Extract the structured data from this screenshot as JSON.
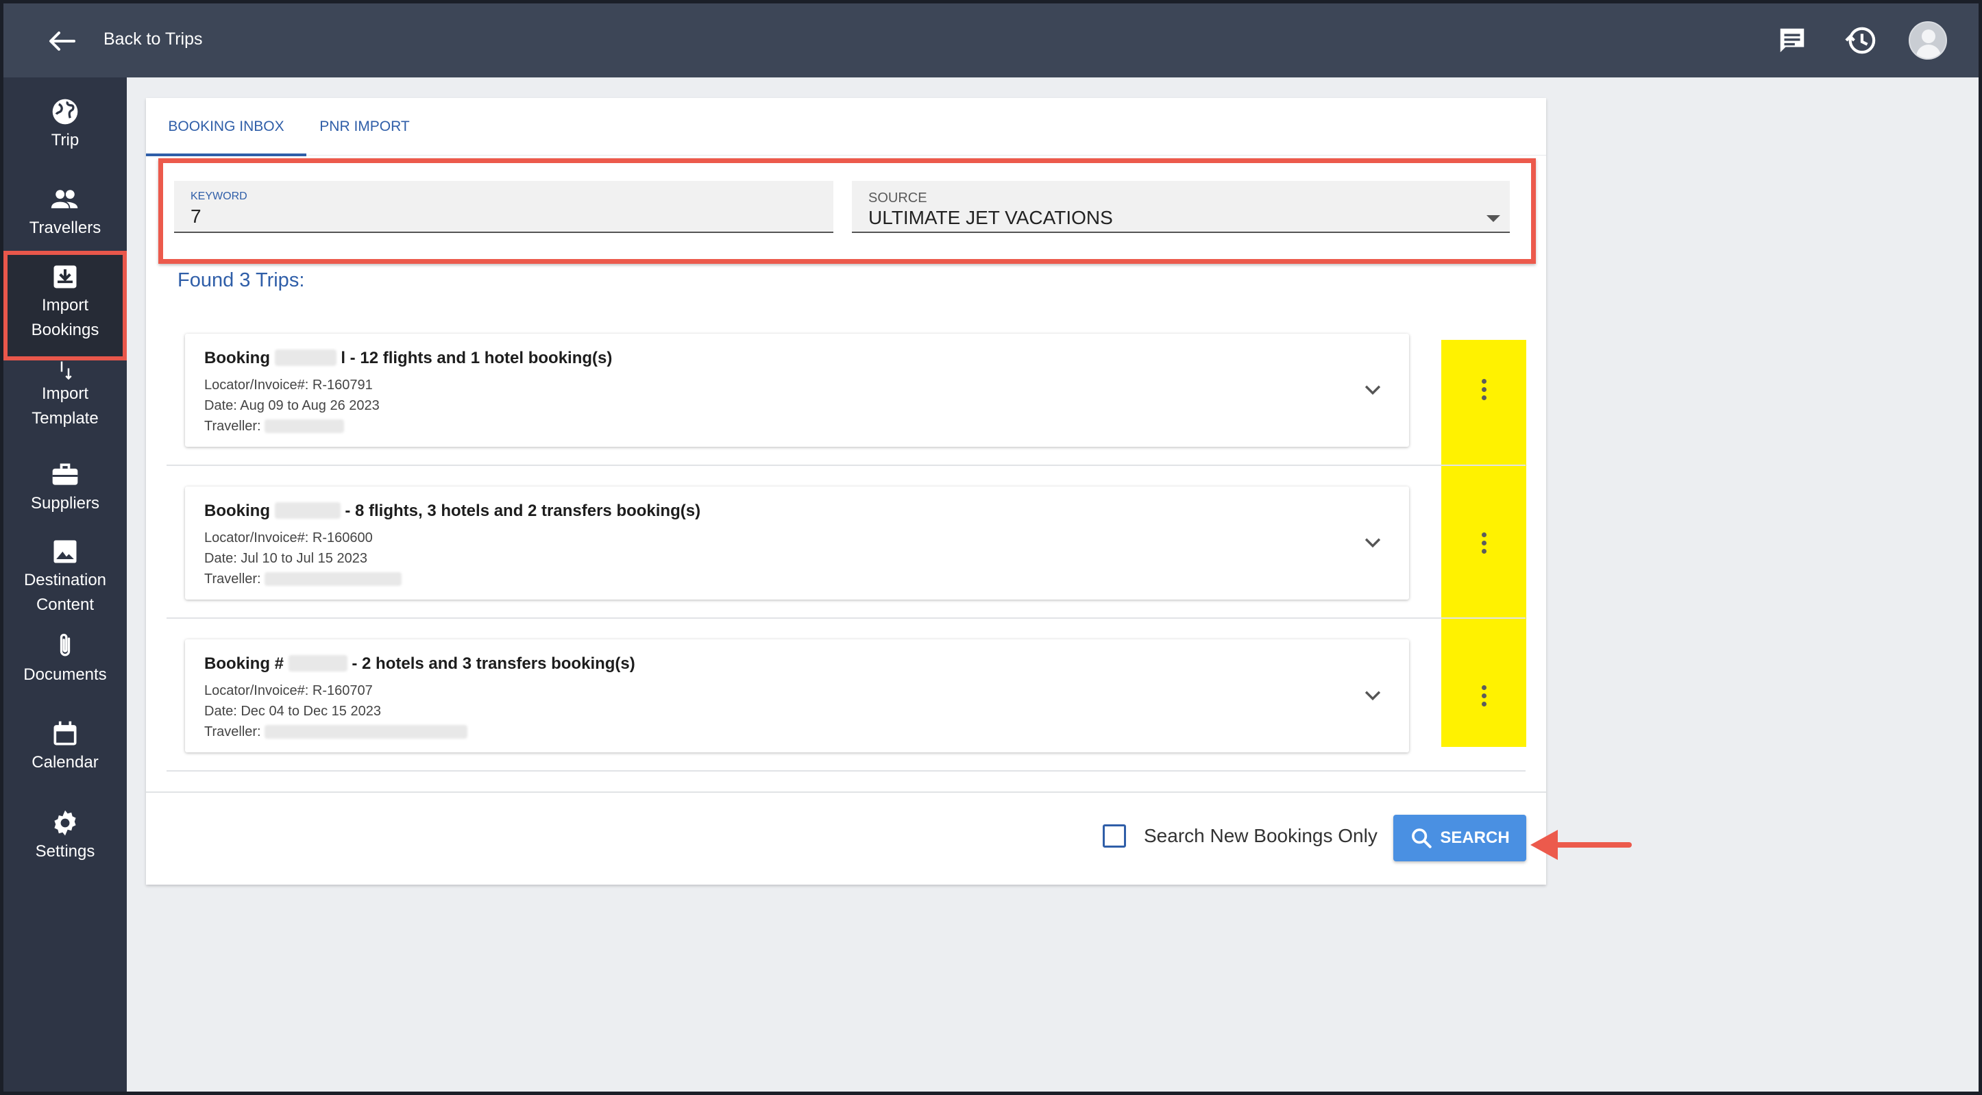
{
  "header": {
    "back_label": "Back to Trips",
    "icons": [
      "arrow-left-icon",
      "chat-icon",
      "history-icon",
      "avatar"
    ]
  },
  "sidebar": {
    "items": [
      {
        "label": "Trip",
        "icon": "globe-icon"
      },
      {
        "label": "Travellers",
        "icon": "people-icon"
      },
      {
        "label": "Import\nBookings",
        "line1": "Import",
        "line2": "Bookings",
        "icon": "inbox-download-icon",
        "active": true
      },
      {
        "label": "Import\nTemplate",
        "line1": "Import",
        "line2": "Template",
        "icon": "swap-vertical-icon"
      },
      {
        "label": "Suppliers",
        "icon": "briefcase-icon"
      },
      {
        "label": "Destination\nContent",
        "line1": "Destination",
        "line2": "Content",
        "icon": "image-icon"
      },
      {
        "label": "Documents",
        "icon": "paperclip-icon"
      },
      {
        "label": "Calendar",
        "icon": "calendar-icon"
      },
      {
        "label": "Settings",
        "icon": "gear-icon"
      }
    ]
  },
  "tabs": [
    {
      "label": "BOOKING INBOX",
      "active": true
    },
    {
      "label": "PNR IMPORT",
      "active": false
    }
  ],
  "filters": {
    "keyword": {
      "label": "KEYWORD",
      "value": "7"
    },
    "source": {
      "label": "SOURCE",
      "value": "ULTIMATE JET VACATIONS"
    }
  },
  "results": {
    "found_text": "Found 3 Trips:",
    "bookings": [
      {
        "prefix": "Booking",
        "suffix": "l - 12 flights and 1 hotel booking(s)",
        "locator": "Locator/Invoice#: R-160791",
        "date": "Date: Aug 09 to Aug 26 2023",
        "traveller": "Traveller:"
      },
      {
        "prefix": "Booking",
        "suffix": "- 8 flights, 3 hotels and 2 transfers booking(s)",
        "locator": "Locator/Invoice#: R-160600",
        "date": "Date: Jul 10 to Jul 15 2023",
        "traveller": "Traveller:"
      },
      {
        "prefix": "Booking #",
        "suffix": "- 2 hotels and 3 transfers booking(s)",
        "locator": "Locator/Invoice#: R-160707",
        "date": "Date: Dec 04 to Dec 15 2023",
        "traveller": "Traveller:"
      }
    ]
  },
  "footer": {
    "checkbox_label": "Search New Bookings Only",
    "checkbox_checked": false,
    "search_label": "SEARCH"
  },
  "colors": {
    "accent": "#2f5ea8",
    "button": "#4a90e2",
    "annotation_red": "#ec5a4c",
    "highlight_yellow": "#fff200"
  }
}
